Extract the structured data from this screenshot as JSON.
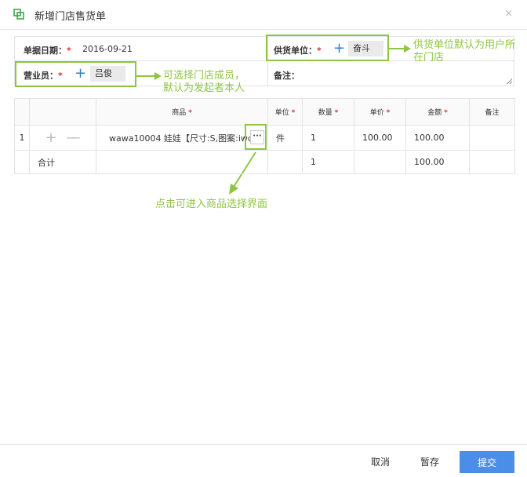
{
  "dialog": {
    "title": "新增门店售货单",
    "title_icon": "copy-icon",
    "close_label": "×"
  },
  "form": {
    "date_label": "单据日期：",
    "date_value": "2016-09-21",
    "supplier_label": "供货单位：",
    "supplier_value": "奋斗",
    "salesperson_label": "营业员：",
    "salesperson_value": "吕俊",
    "remark_label": "备注：",
    "required_mark": "*",
    "add_icon": "plus-icon"
  },
  "annotations": {
    "supplier_note": "供货单位默认为用户所在门店",
    "salesperson_note_line1": "可选择门店成员，",
    "salesperson_note_line2": "默认为发起者本人",
    "product_note": "点击可进入商品选择界面"
  },
  "table": {
    "headers": {
      "product": "商品",
      "unit": "单位",
      "quantity": "数量",
      "price": "单价",
      "amount": "金额",
      "remark": "备注"
    },
    "rows": [
      {
        "index": "1",
        "add": "+",
        "remove": "—",
        "product": "wawa10004 娃娃【尺寸:S,图案:iwc",
        "picker": "···",
        "unit": "件",
        "quantity": "1",
        "price": "100.00",
        "amount": "100.00",
        "remark": ""
      }
    ],
    "total": {
      "label": "合计",
      "quantity": "1",
      "amount": "100.00"
    }
  },
  "footer": {
    "cancel": "取消",
    "save": "暂存",
    "submit": "提交"
  },
  "colors": {
    "accent": "#4a8ee8",
    "highlight": "#8dc63f",
    "required": "#e03030"
  }
}
